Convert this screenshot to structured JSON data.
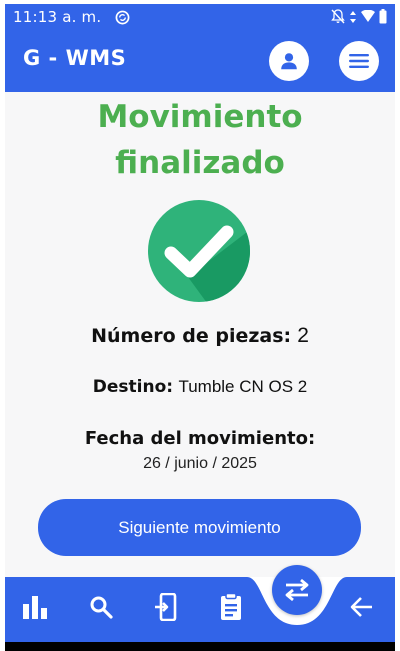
{
  "colors": {
    "primary": "#3264e8",
    "success": "#4caf50",
    "check": "#2fb37a"
  },
  "status_bar": {
    "time": "11:13 a. m.",
    "icons": [
      "sync-icon",
      "notifications-off-icon",
      "data-arrows-icon",
      "wifi-icon",
      "battery-icon"
    ]
  },
  "app_bar": {
    "title": "G - WMS",
    "profile_icon": "account-icon",
    "menu_icon": "menu-icon"
  },
  "main": {
    "title_line1": "Movimiento",
    "title_line2": "finalizado",
    "pieces_label": "Número de piezas:",
    "pieces_value": "2",
    "destination_label": "Destino:",
    "destination_value": "Tumble CN OS 2",
    "date_label": "Fecha del movimiento:",
    "date_value": "26 / junio / 2025",
    "next_button": "Siguiente movimiento"
  },
  "bottom_nav": {
    "items": [
      "bar-chart-icon",
      "search-icon",
      "mobile-transfer-icon",
      "clipboard-icon",
      "swap-icon",
      "back-arrow-icon"
    ]
  }
}
